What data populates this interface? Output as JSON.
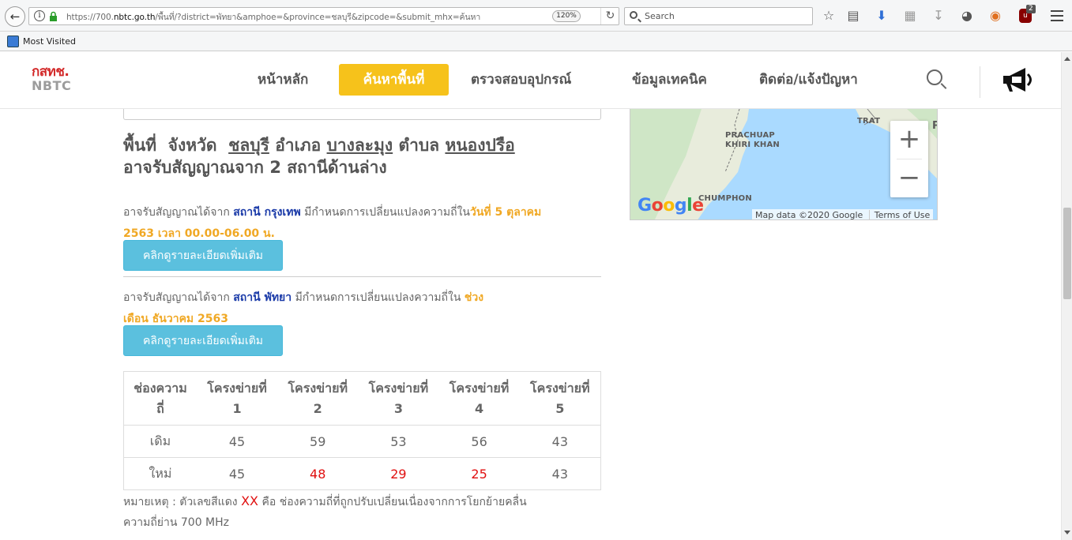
{
  "browser": {
    "url_prefix": "https://700.",
    "url_host": "nbtc.go.th",
    "url_rest": "/พื้นที่/?district=พัทยา&amphoe=&province=ชลบุรี&zipcode=&submit_mhx=ค้นหา",
    "zoom": "120%",
    "search_placeholder": "Search",
    "ublock_count": "2",
    "bookmark_label": "Most Visited"
  },
  "site": {
    "logo_th": "กสทช.",
    "logo_en": "NBTC",
    "menu": [
      "หน้าหลัก",
      "ค้นหาพื้นที่",
      "ตรวจสอบอุปกรณ์",
      "ข้อมูลเทคนิค",
      "ติดต่อ/แจ้งปัญหา"
    ]
  },
  "area": {
    "w1": "พื้นที่",
    "w2": "จังหวัด",
    "province": "ชลบุรี",
    "w3": "อำเภอ",
    "amphoe": "บางละมุง",
    "w4": "ตำบล",
    "tambon": "หนองปรือ",
    "line2": "อาจรับสัญญาณจาก 2 สถานีด้านล่าง"
  },
  "stations": [
    {
      "prefix": "อาจรับสัญญาณได้จาก",
      "station": "สถานี กรุงเทพ",
      "middle": "มีกำหนดการเปลี่ยนแปลงความถี่ใน",
      "date_part1": "วันที่ 5 ตุลาคม",
      "date_part2": "2563 เวลา 00.00-06.00 น.",
      "button": "คลิกดูรายละเอียดเพิ่มเติม"
    },
    {
      "prefix": "อาจรับสัญญาณได้จาก",
      "station": "สถานี พัทยา",
      "middle": "มีกำหนดการเปลี่ยนแปลงความถี่ใน",
      "date_part1": "ช่วง",
      "date_part2": "เดือน ธันวาคม 2563",
      "button": "คลิกดูรายละเอียดเพิ่มเติม"
    }
  ],
  "table": {
    "headers": [
      {
        "l1": "ช่องความ",
        "l2": "ถี่"
      },
      {
        "l1": "โครงข่ายที่",
        "l2": "1"
      },
      {
        "l1": "โครงข่ายที่",
        "l2": "2"
      },
      {
        "l1": "โครงข่ายที่",
        "l2": "3"
      },
      {
        "l1": "โครงข่ายที่",
        "l2": "4"
      },
      {
        "l1": "โครงข่ายที่",
        "l2": "5"
      }
    ],
    "rows": [
      {
        "label": "เดิม",
        "values": [
          "45",
          "59",
          "53",
          "56",
          "43"
        ],
        "changed": [
          false,
          false,
          false,
          false,
          false
        ]
      },
      {
        "label": "ใหม่",
        "values": [
          "45",
          "48",
          "29",
          "25",
          "43"
        ],
        "changed": [
          false,
          true,
          true,
          true,
          false
        ]
      }
    ]
  },
  "note": {
    "prefix": "หมายเหตุ : ตัวเลขสีแดง",
    "xx": "XX",
    "suffix": "คือ ช่องความถี่ที่ถูกปรับเปลี่ยนเนื่องจากการโยกย้ายคลื่น",
    "line2": "ความถี่ย่าน 700 MHz"
  },
  "map": {
    "labels": [
      "PRACHUAP",
      "KHIRI KHAN",
      "CHUMPHON",
      "TRAT",
      "P"
    ],
    "attribution": "Map data ©2020 Google",
    "terms": "Terms of Use",
    "google": "Google"
  },
  "colors": {
    "accent": "#f6c21b",
    "button": "#5bc0de",
    "station": "#1a3aa8",
    "date": "#f0a824",
    "changed": "#e01010"
  }
}
